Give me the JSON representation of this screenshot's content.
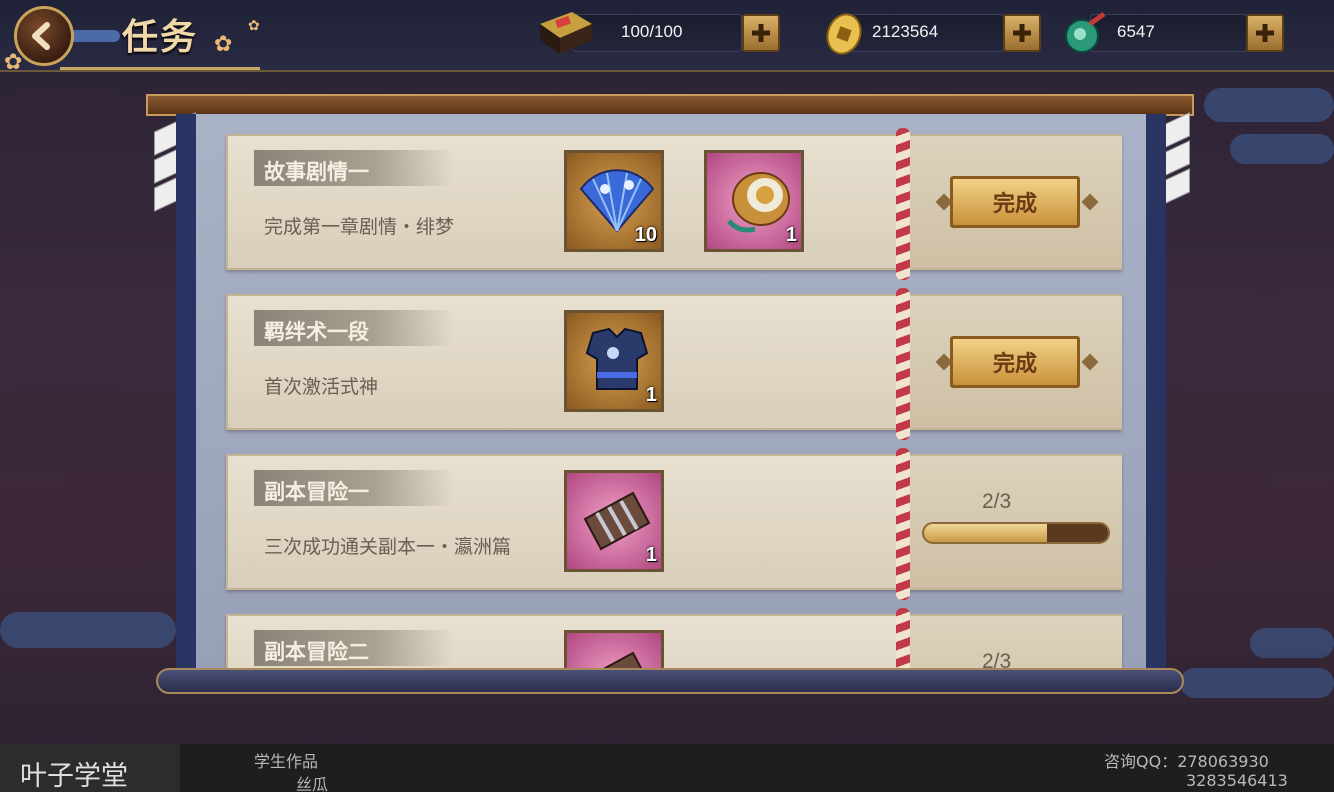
{
  "header": {
    "title": "任务",
    "resources": [
      {
        "icon": "lunch-box-icon",
        "value": "100/100"
      },
      {
        "icon": "gold-coin-icon",
        "value": "2123564"
      },
      {
        "icon": "jade-magatama-icon",
        "value": "6547"
      }
    ]
  },
  "tasks": [
    {
      "name": "故事剧情一",
      "desc": "完成第一章剧情・绯梦",
      "rewards": [
        {
          "icon": "folding-fan-icon",
          "count": "10"
        },
        {
          "icon": "drum-icon",
          "count": "1"
        }
      ],
      "status": "complete",
      "action_label": "完成"
    },
    {
      "name": "羁绊术一段",
      "desc": "首次激活式神",
      "rewards": [
        {
          "icon": "armor-icon",
          "count": "1"
        }
      ],
      "status": "complete",
      "action_label": "完成"
    },
    {
      "name": "副本冒险一",
      "desc": "三次成功通关副本一・瀛洲篇",
      "rewards": [
        {
          "icon": "gauntlet-icon",
          "count": "1"
        }
      ],
      "status": "progress",
      "progress_text": "2/3",
      "progress": 0.667
    },
    {
      "name": "副本冒险二",
      "desc": "",
      "rewards": [
        {
          "icon": "gauntlet-icon",
          "count": ""
        }
      ],
      "status": "progress",
      "progress_text": "2/3"
    }
  ],
  "footer": {
    "brand": "叶子学堂",
    "label": "学生作品",
    "author": "丝瓜",
    "contact": "咨询QQ：278063930",
    "contact2": "3283546413"
  },
  "colors": {
    "accent_gold": "#c8923a",
    "panel_navy": "#2a3462",
    "rope_red": "#c23a4a"
  }
}
